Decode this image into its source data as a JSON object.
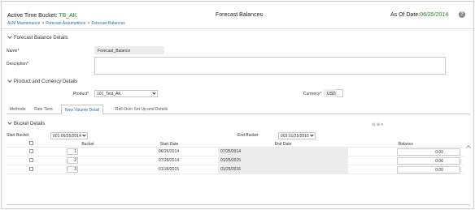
{
  "header": {
    "bucket_label": "Active Time Bucket: ",
    "bucket_value": "TB_AK",
    "breadcrumbs": [
      "ALM Maintenance",
      "Forecast Assumptions",
      "Forecast Balances"
    ],
    "breadcrumb_sep": ">",
    "title": "Forecast Balances",
    "asof_label": "As Of Date:",
    "asof_value": "06/25/2014",
    "help_icon": "?"
  },
  "forecast_details": {
    "section_label": "Forecast Balance Details",
    "name_label": "Name",
    "name_value": "Forecast_Balance",
    "description_label": "Description",
    "required_mark": "*"
  },
  "product_currency": {
    "section_label": "Product and Currency Details",
    "product_label": "Product",
    "product_value": "101_Test_AK",
    "currency_label": "Currency",
    "currency_value": "USD"
  },
  "tabs": [
    "Methods",
    "Rate Tiers",
    "New Volume Detail",
    "Roll-Over Set Up and Details"
  ],
  "active_tab": "New Volume Detail",
  "bucket_details": {
    "section_label": "Bucket Details",
    "start_bucket_label": "Start Bucket",
    "start_bucket_value": "001:06/26/2014",
    "end_bucket_label": "End Bucket",
    "end_bucket_value": "003:01/25/2016",
    "tool_icons": "⚙ ⊕ ▾",
    "columns": [
      "Bucket",
      "Start Date",
      "End Date",
      "Balance"
    ],
    "rows": [
      {
        "bucket": "1",
        "start_date": "06/26/2014",
        "end_date": "07/25/2014",
        "balance": "0.00"
      },
      {
        "bucket": "2",
        "start_date": "07/26/2014",
        "end_date": "01/25/2015",
        "balance": "0.00"
      },
      {
        "bucket": "3",
        "start_date": "01/26/2015",
        "end_date": "01/25/2016",
        "balance": "0.00"
      }
    ]
  },
  "colors": {
    "accent_green": "#2a7d2a",
    "link_blue": "#1d6fb8"
  }
}
